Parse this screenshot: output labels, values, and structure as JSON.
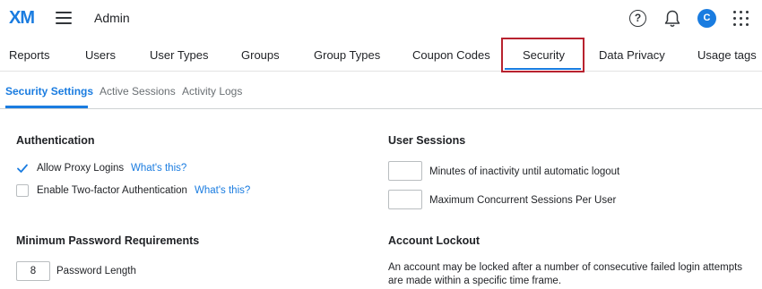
{
  "header": {
    "logo": "XM",
    "title": "Admin",
    "help_glyph": "?",
    "avatar_initial": "C"
  },
  "nav": {
    "tabs": [
      {
        "label": "Reports"
      },
      {
        "label": "Users"
      },
      {
        "label": "User Types"
      },
      {
        "label": "Groups"
      },
      {
        "label": "Group Types"
      },
      {
        "label": "Coupon Codes"
      },
      {
        "label": "Security"
      },
      {
        "label": "Data Privacy"
      },
      {
        "label": "Usage tags"
      }
    ],
    "active": "Security"
  },
  "subnav": {
    "tabs": [
      {
        "label": "Security Settings"
      },
      {
        "label": "Active Sessions"
      },
      {
        "label": "Activity Logs"
      }
    ],
    "active": "Security Settings"
  },
  "authentication": {
    "title": "Authentication",
    "allow_proxy_label": "Allow Proxy Logins",
    "allow_proxy_checked": true,
    "allow_proxy_link": "What's this?",
    "two_factor_label": "Enable Two-factor Authentication",
    "two_factor_checked": false,
    "two_factor_link": "What's this?"
  },
  "password": {
    "title": "Minimum Password Requirements",
    "length_value": "8",
    "length_label": "Password Length"
  },
  "user_sessions": {
    "title": "User Sessions",
    "inactivity_value": "",
    "inactivity_label": "Minutes of inactivity until automatic logout",
    "concurrent_value": "",
    "concurrent_label": "Maximum Concurrent Sessions Per User"
  },
  "account_lockout": {
    "title": "Account Lockout",
    "description": "An account may be locked after a number of consecutive failed login attempts are made within a specific time frame."
  },
  "colors": {
    "accent": "#1a7ce0",
    "highlight_box": "#b8222f"
  }
}
